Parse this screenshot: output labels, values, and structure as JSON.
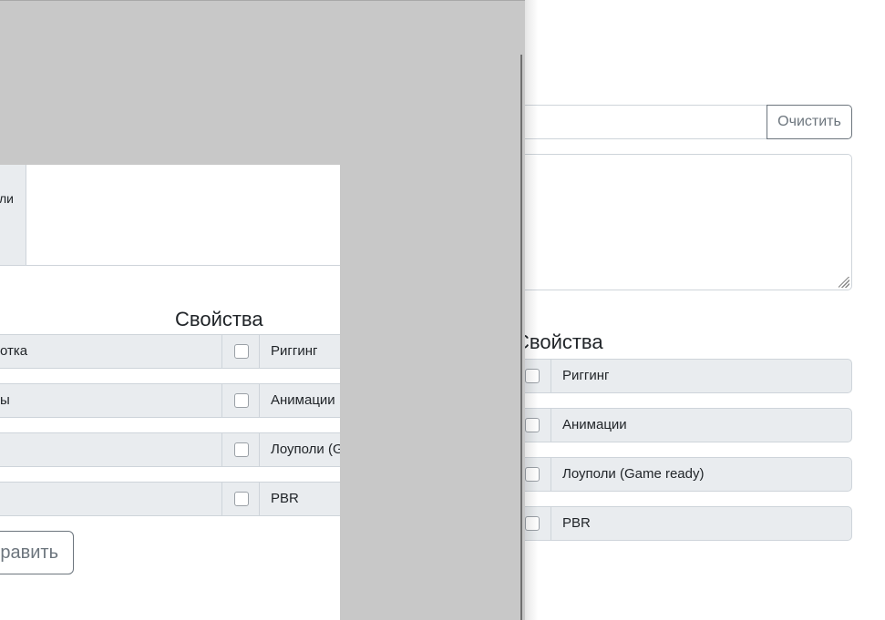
{
  "background_form": {
    "clear_button_label": "Очистить",
    "properties_title": "Свойства",
    "properties": [
      {
        "label": "Риггинг",
        "checked": false
      },
      {
        "label": "Анимации",
        "checked": false
      },
      {
        "label": "Лоуполи (Game ready)",
        "checked": false
      },
      {
        "label": "PBR",
        "checked": false
      }
    ]
  },
  "foreground_form": {
    "top_cell_text": "ли",
    "properties_title": "Свойства",
    "left_rows": [
      "отка",
      "ы",
      "",
      ""
    ],
    "properties": [
      {
        "label": "Риггинг",
        "checked": false
      },
      {
        "label": "Анимации",
        "checked": false
      },
      {
        "label": "Лоуполи (G",
        "checked": false
      },
      {
        "label": "PBR",
        "checked": false
      }
    ],
    "send_button_label": "равить"
  },
  "colors": {
    "overlay_gray": "#c8c8c8",
    "input_group_bg": "#e9ecef",
    "border": "#ced4da",
    "secondary": "#6c757d"
  }
}
